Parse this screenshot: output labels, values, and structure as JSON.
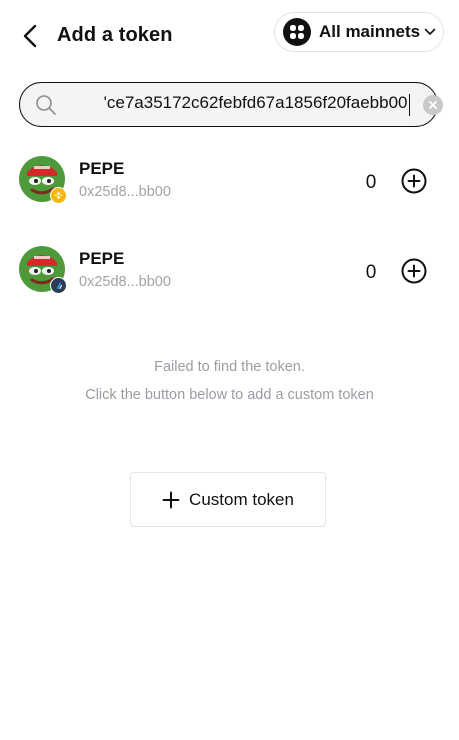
{
  "header": {
    "title": "Add a token",
    "network_label": "All mainnets"
  },
  "search": {
    "value": "'ce7a35172c62febfd67a1856f20faebb00"
  },
  "tokens": [
    {
      "name": "PEPE",
      "address": "0x25d8...bb00",
      "balance": "0",
      "chain_badge_color": "#f0b90b"
    },
    {
      "name": "PEPE",
      "address": "0x25d8...bb00",
      "balance": "0",
      "chain_badge_color": "#2d3b55"
    }
  ],
  "empty_state": {
    "line1": "Failed to find the token.",
    "line2": "Click the button below to add a custom token"
  },
  "custom_button": {
    "label": "Custom token"
  }
}
